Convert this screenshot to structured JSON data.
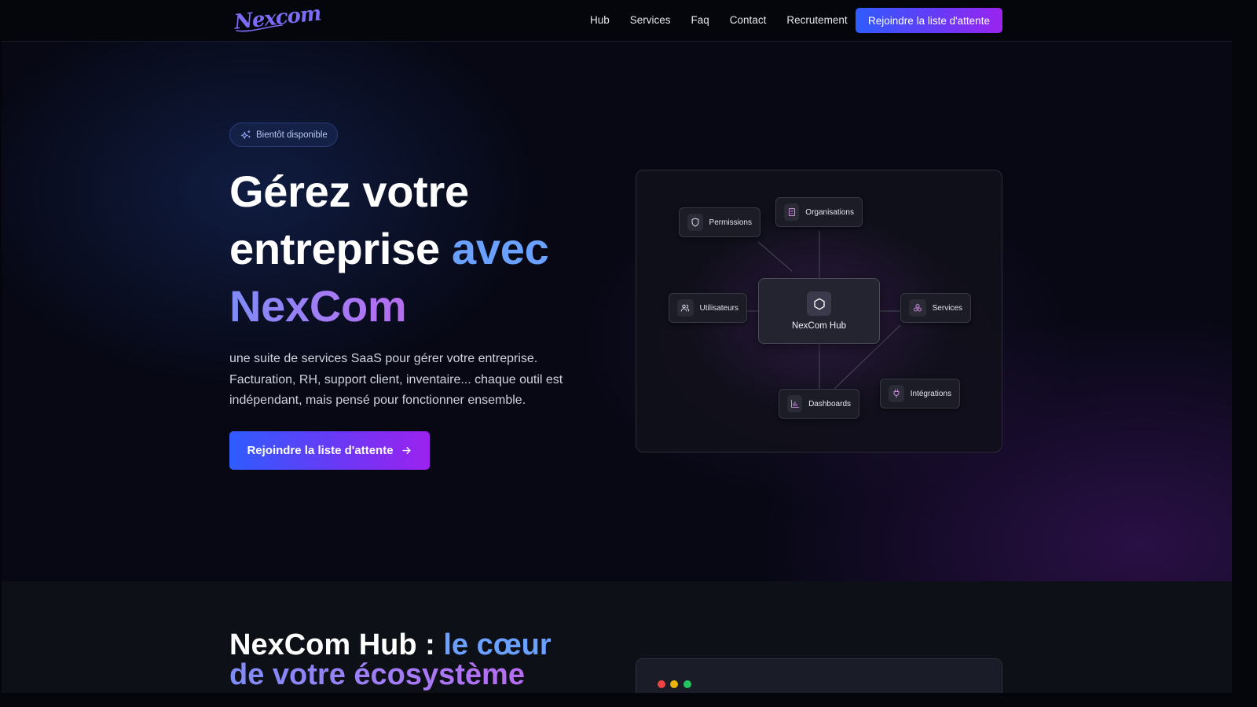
{
  "nav": {
    "logo_text": "Nexcom",
    "links": [
      "Hub",
      "Services",
      "Faq",
      "Contact",
      "Recrutement"
    ],
    "cta_label": "Rejoindre la liste d'attente"
  },
  "hero": {
    "badge": "Bientôt disponible",
    "headline_part1": "Gérez votre entreprise ",
    "headline_part2": "avec",
    "headline_part3": "NexCom",
    "description": "une suite de services SaaS pour gérer votre entreprise. Facturation, RH, support client, inventaire... chaque outil est indépendant, mais pensé pour fonctionner ensemble.",
    "cta_label": "Rejoindre la liste d'attente"
  },
  "diagram": {
    "hub_label": "NexCom Hub",
    "nodes": {
      "permissions": "Permissions",
      "organisations": "Organisations",
      "utilisateurs": "Utilisateurs",
      "services": "Services",
      "dashboards": "Dashboards",
      "integrations": "Intégrations"
    },
    "icons": {
      "permissions": "shield-icon",
      "organisations": "building-icon",
      "utilisateurs": "users-icon",
      "services": "blocks-icon",
      "dashboards": "bar-chart-icon",
      "integrations": "plug-icon",
      "hub": "hexagon-icon"
    }
  },
  "section2": {
    "title_part1": "NexCom Hub : ",
    "title_part2": "le cœur",
    "title_part3": "de votre écosystème"
  },
  "colors": {
    "accent_blue": "#2f5cff",
    "accent_purple": "#9a24f0",
    "highlight_blue": "#6aa0ff",
    "dot_red": "#ef4444",
    "dot_yellow": "#eab308",
    "dot_green": "#22c55e"
  }
}
